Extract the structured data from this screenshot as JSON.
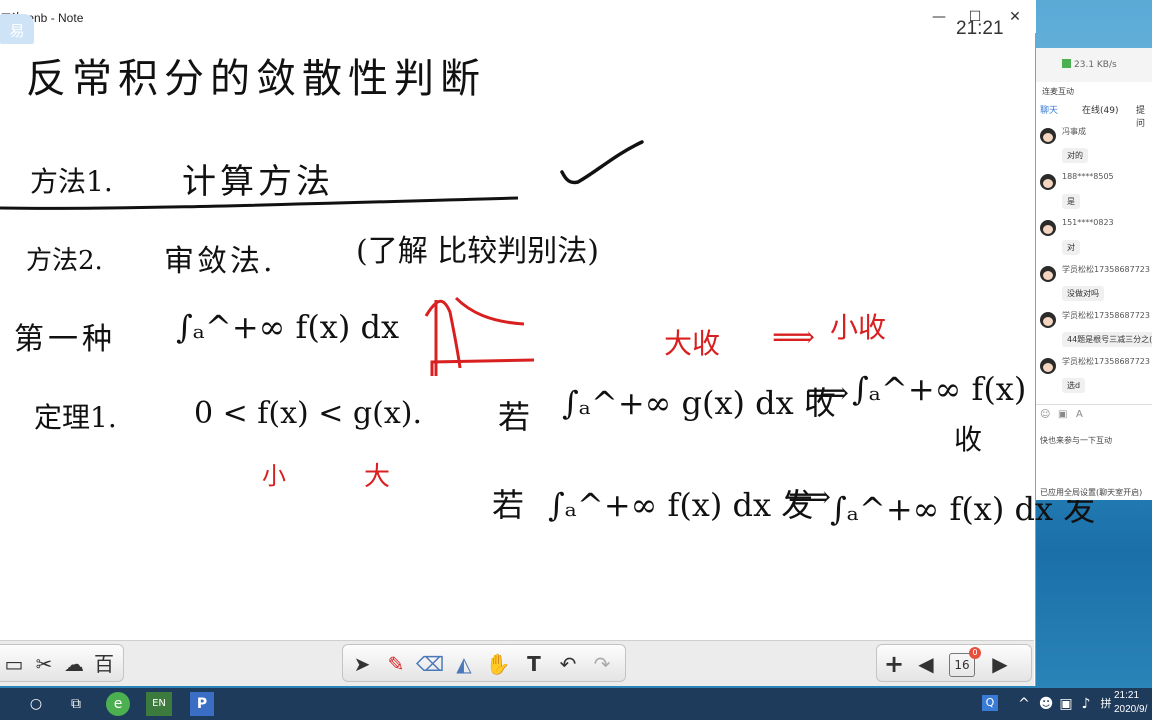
{
  "window": {
    "title": "二次.enb - Note",
    "minimize": "—",
    "maximize": "☐",
    "close": "✕",
    "clock": "21:21",
    "logo_char": "易"
  },
  "board": {
    "title": "反常积分的敛散性判断",
    "method1_label": "方法1.",
    "method1_name": "计算方法",
    "check_mark": "✓",
    "method2_label": "方法2.",
    "method2_name": "审敛法.",
    "method2_note": "(了解 比较判别法)",
    "first_kind_label": "第一种",
    "first_kind_integral": "∫ₐ^+∞ f(x) dx",
    "big_converge": "大收",
    "implies_1": "⟹",
    "small_converge": "小收",
    "theorem_label": "定理1.",
    "inequality": "0 < f(x) < g(x).",
    "small_label": "小",
    "big_label": "大",
    "ruo_1": "若",
    "converge_statement_left": "∫ₐ^+∞ g(x) dx 收",
    "implies_2": "⟹",
    "converge_statement_right": "∫ₐ^+∞ f(x) dx",
    "converge_result": "收",
    "ruo_2": "若",
    "diverge_statement_left": "∫ₐ^+∞ f(x) dx 发",
    "implies_3": "⟹",
    "diverge_statement_right": "∫ₐ^+∞ f(x) dx 发"
  },
  "toolbar": {
    "left_tools": [
      "screen-icon",
      "tools-icon",
      "cloud-icon",
      "baidu-icon"
    ],
    "left_glyphs": [
      "▭",
      "✂",
      "☁",
      "百"
    ],
    "center_tools": [
      "pointer-icon",
      "pen-icon",
      "eraser-icon",
      "shape-icon",
      "hand-icon",
      "text-icon",
      "undo-icon",
      "redo-icon"
    ],
    "center_glyphs": [
      "➤",
      "✎",
      "⌫",
      "◭",
      "✋",
      "T",
      "↶",
      "↷"
    ],
    "add_page": "+",
    "prev_page": "◀",
    "page_number": "16",
    "page_badge": "0",
    "next_page": "▶"
  },
  "chat": {
    "speed": "23.1 KB/s",
    "section_label": "连麦互动",
    "tabs": [
      "聊天",
      "在线(49)",
      "提问"
    ],
    "messages": [
      {
        "name": "冯事成",
        "text": "对的"
      },
      {
        "name": "188****8505",
        "text": "是"
      },
      {
        "name": "151****0823",
        "text": "对"
      },
      {
        "name": "学员松松17358687723",
        "text": "没做对吗"
      },
      {
        "name": "学员松松17358687723",
        "text": "44题是根号三减三分之("
      },
      {
        "name": "学员松松17358687723",
        "text": "选d"
      }
    ],
    "join_hint": "快也来参与一下互动",
    "settings_hint": "已应用全局设置(聊天室开启)"
  },
  "taskbar": {
    "time": "21:21",
    "date": "2020/9/",
    "lang": "EN",
    "colors": {
      "bar": "#1f3b5c",
      "accent_red": "#d82020"
    }
  }
}
